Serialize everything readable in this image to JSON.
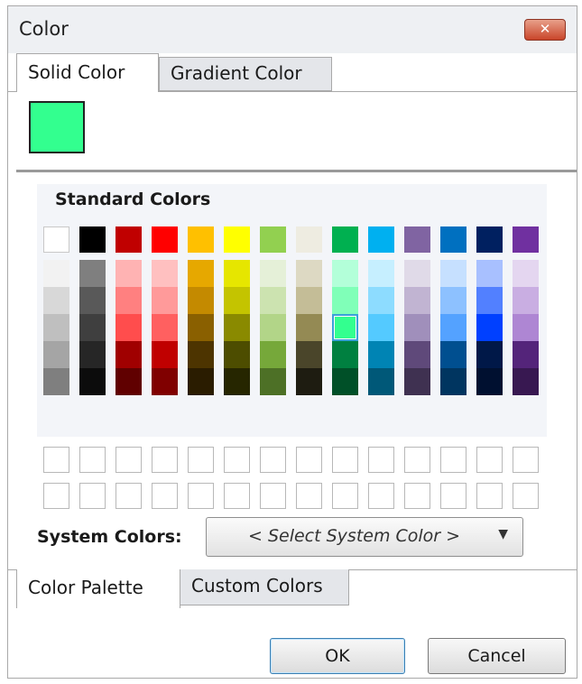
{
  "window": {
    "title": "Color",
    "close_glyph": "✕"
  },
  "top_tabs": [
    {
      "label": "Solid Color",
      "active": true
    },
    {
      "label": "Gradient Color",
      "active": false
    }
  ],
  "selected_color": "#33ff8f",
  "palette": {
    "header": "Standard Colors",
    "top_row": [
      "#ffffff",
      "#000000",
      "#c00000",
      "#ff0000",
      "#ffc000",
      "#ffff00",
      "#92d050",
      "#eeece1",
      "#00b050",
      "#00b0f0",
      "#8064a2",
      "#0070c0",
      "#002060",
      "#7030a0"
    ],
    "shade_columns": [
      [
        "#f2f2f2",
        "#d8d8d8",
        "#bfbfbf",
        "#a5a5a5",
        "#7f7f7f"
      ],
      [
        "#7f7f7f",
        "#595959",
        "#3f3f3f",
        "#262626",
        "#0c0c0c"
      ],
      [
        "#ffb3b3",
        "#ff8080",
        "#ff4d4d",
        "#a00000",
        "#600000"
      ],
      [
        "#ffc0c0",
        "#ff9a9a",
        "#ff6060",
        "#c00000",
        "#800000"
      ],
      [
        "#e6a800",
        "#c48a00",
        "#8a6000",
        "#4d3400",
        "#2a1c00"
      ],
      [
        "#e6e600",
        "#c4c400",
        "#8a8a00",
        "#4d4d00",
        "#262600"
      ],
      [
        "#e5f0d8",
        "#cce3b0",
        "#b2d588",
        "#76a83a",
        "#4d7026"
      ],
      [
        "#ddd9c3",
        "#c4bd97",
        "#948a54",
        "#4a452a",
        "#1e1c11"
      ],
      [
        "#b3ffd9",
        "#80ffb8",
        "#33ff8f",
        "#008040",
        "#005028"
      ],
      [
        "#c6efff",
        "#8ddcff",
        "#54caff",
        "#0084b4",
        "#005878"
      ],
      [
        "#e0dae8",
        "#c1b4d2",
        "#a08fbb",
        "#5f497a",
        "#3f3151"
      ],
      [
        "#c6e0ff",
        "#8dc1ff",
        "#54a2ff",
        "#004f90",
        "#003560"
      ],
      [
        "#a8c0ff",
        "#5280ff",
        "#0040ff",
        "#001848",
        "#001030"
      ],
      [
        "#e4d6f0",
        "#c9aee2",
        "#ae86d3",
        "#54247a",
        "#381851"
      ]
    ],
    "selected_column": 8,
    "selected_row": 2
  },
  "system_colors": {
    "label": "System Colors:",
    "placeholder": "< Select System Color >",
    "arrow": "▼"
  },
  "bottom_tabs": [
    {
      "label": "Color Palette",
      "active": true
    },
    {
      "label": "Custom Colors",
      "active": false
    }
  ],
  "buttons": {
    "ok": "OK",
    "cancel": "Cancel"
  }
}
